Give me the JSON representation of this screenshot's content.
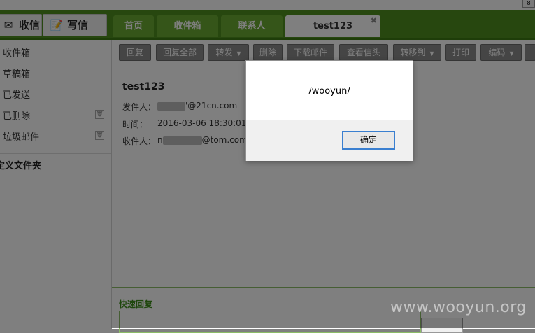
{
  "header": {
    "corner_label": "8",
    "inbox_button": "收信",
    "compose_button": "写信",
    "tabs": [
      {
        "label": "首页"
      },
      {
        "label": "收件箱"
      },
      {
        "label": "联系人"
      },
      {
        "label": "test123",
        "close": "✖"
      }
    ]
  },
  "sidebar": {
    "folders": [
      {
        "label": "收件箱"
      },
      {
        "label": "草稿箱"
      },
      {
        "label": "已发送"
      },
      {
        "label": "已删除",
        "icon": "trash-icon"
      },
      {
        "label": "垃圾邮件",
        "icon": "trash-icon"
      }
    ],
    "custom_folder": "定义文件夹"
  },
  "toolbar": {
    "buttons": [
      {
        "label": "回复"
      },
      {
        "label": "回复全部"
      },
      {
        "label": "转发",
        "dropdown": true
      },
      {
        "label": "删除"
      },
      {
        "label": "下载邮件"
      },
      {
        "label": "查看信头"
      },
      {
        "label": "转移到",
        "dropdown": true
      },
      {
        "label": "打印"
      },
      {
        "label": "编码",
        "dropdown": true
      },
      {
        "label": "_"
      }
    ]
  },
  "mail": {
    "subject": "test123",
    "from_label": "发件人：",
    "from_value": "'@21cn.com",
    "time_label": "时间：",
    "time_value": "2016-03-06 18:30:01",
    "to_label": "收件人：",
    "to_prefix": "n",
    "to_value": "@tom.com"
  },
  "quick_reply": {
    "label": "快速回复"
  },
  "dialog": {
    "message": "/wooyun/",
    "ok_label": "确定"
  },
  "watermark": "www.wooyun.org",
  "colors": {
    "nav_green": "#4e8f1e",
    "tab_green": "#6aaa33",
    "toolbar_button": "#8a8a8a",
    "focus_blue": "#3a7fd0"
  }
}
